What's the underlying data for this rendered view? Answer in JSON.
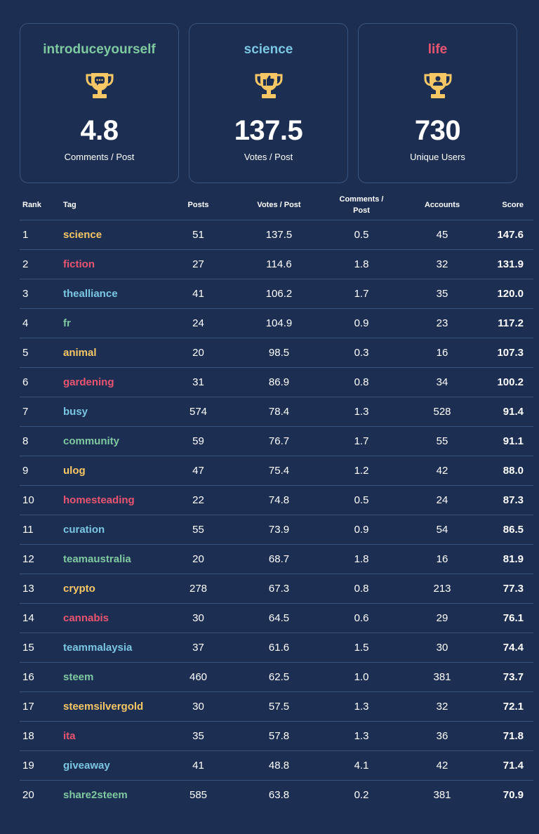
{
  "colors": {
    "background": "#1c2f52",
    "border": "#3a5480",
    "green": "#7fc9a0",
    "blue": "#7bc6e3",
    "red": "#ea5470",
    "yellow": "#f8c765"
  },
  "cards": [
    {
      "tag": "introduceyourself",
      "tag_color": "#7fc9a0",
      "icon": "trophy-comment-icon",
      "value": "4.8",
      "label": "Comments / Post"
    },
    {
      "tag": "science",
      "tag_color": "#7bc6e3",
      "icon": "trophy-thumbs-up-icon",
      "value": "137.5",
      "label": "Votes / Post"
    },
    {
      "tag": "life",
      "tag_color": "#ea5470",
      "icon": "trophy-user-icon",
      "value": "730",
      "label": "Unique Users"
    }
  ],
  "table": {
    "headers": {
      "rank": "Rank",
      "tag": "Tag",
      "posts": "Posts",
      "votes_per_post": "Votes / Post",
      "comments_per_post_line1": "Comments /",
      "comments_per_post_line2": "Post",
      "accounts": "Accounts",
      "score": "Score"
    },
    "rows": [
      {
        "rank": "1",
        "tag": "science",
        "tag_color": "#f8c765",
        "posts": "51",
        "votes": "137.5",
        "comments": "0.5",
        "accounts": "45",
        "score": "147.6"
      },
      {
        "rank": "2",
        "tag": "fiction",
        "tag_color": "#ea5470",
        "posts": "27",
        "votes": "114.6",
        "comments": "1.8",
        "accounts": "32",
        "score": "131.9"
      },
      {
        "rank": "3",
        "tag": "thealliance",
        "tag_color": "#7bc6e3",
        "posts": "41",
        "votes": "106.2",
        "comments": "1.7",
        "accounts": "35",
        "score": "120.0"
      },
      {
        "rank": "4",
        "tag": "fr",
        "tag_color": "#7fc9a0",
        "posts": "24",
        "votes": "104.9",
        "comments": "0.9",
        "accounts": "23",
        "score": "117.2"
      },
      {
        "rank": "5",
        "tag": "animal",
        "tag_color": "#f8c765",
        "posts": "20",
        "votes": "98.5",
        "comments": "0.3",
        "accounts": "16",
        "score": "107.3"
      },
      {
        "rank": "6",
        "tag": "gardening",
        "tag_color": "#ea5470",
        "posts": "31",
        "votes": "86.9",
        "comments": "0.8",
        "accounts": "34",
        "score": "100.2"
      },
      {
        "rank": "7",
        "tag": "busy",
        "tag_color": "#7bc6e3",
        "posts": "574",
        "votes": "78.4",
        "comments": "1.3",
        "accounts": "528",
        "score": "91.4"
      },
      {
        "rank": "8",
        "tag": "community",
        "tag_color": "#7fc9a0",
        "posts": "59",
        "votes": "76.7",
        "comments": "1.7",
        "accounts": "55",
        "score": "91.1"
      },
      {
        "rank": "9",
        "tag": "ulog",
        "tag_color": "#f8c765",
        "posts": "47",
        "votes": "75.4",
        "comments": "1.2",
        "accounts": "42",
        "score": "88.0"
      },
      {
        "rank": "10",
        "tag": "homesteading",
        "tag_color": "#ea5470",
        "posts": "22",
        "votes": "74.8",
        "comments": "0.5",
        "accounts": "24",
        "score": "87.3"
      },
      {
        "rank": "11",
        "tag": "curation",
        "tag_color": "#7bc6e3",
        "posts": "55",
        "votes": "73.9",
        "comments": "0.9",
        "accounts": "54",
        "score": "86.5"
      },
      {
        "rank": "12",
        "tag": "teamaustralia",
        "tag_color": "#7fc9a0",
        "posts": "20",
        "votes": "68.7",
        "comments": "1.8",
        "accounts": "16",
        "score": "81.9"
      },
      {
        "rank": "13",
        "tag": "crypto",
        "tag_color": "#f8c765",
        "posts": "278",
        "votes": "67.3",
        "comments": "0.8",
        "accounts": "213",
        "score": "77.3"
      },
      {
        "rank": "14",
        "tag": "cannabis",
        "tag_color": "#ea5470",
        "posts": "30",
        "votes": "64.5",
        "comments": "0.6",
        "accounts": "29",
        "score": "76.1"
      },
      {
        "rank": "15",
        "tag": "teammalaysia",
        "tag_color": "#7bc6e3",
        "posts": "37",
        "votes": "61.6",
        "comments": "1.5",
        "accounts": "30",
        "score": "74.4"
      },
      {
        "rank": "16",
        "tag": "steem",
        "tag_color": "#7fc9a0",
        "posts": "460",
        "votes": "62.5",
        "comments": "1.0",
        "accounts": "381",
        "score": "73.7"
      },
      {
        "rank": "17",
        "tag": "steemsilvergold",
        "tag_color": "#f8c765",
        "posts": "30",
        "votes": "57.5",
        "comments": "1.3",
        "accounts": "32",
        "score": "72.1"
      },
      {
        "rank": "18",
        "tag": "ita",
        "tag_color": "#ea5470",
        "posts": "35",
        "votes": "57.8",
        "comments": "1.3",
        "accounts": "36",
        "score": "71.8"
      },
      {
        "rank": "19",
        "tag": "giveaway",
        "tag_color": "#7bc6e3",
        "posts": "41",
        "votes": "48.8",
        "comments": "4.1",
        "accounts": "42",
        "score": "71.4"
      },
      {
        "rank": "20",
        "tag": "share2steem",
        "tag_color": "#7fc9a0",
        "posts": "585",
        "votes": "63.8",
        "comments": "0.2",
        "accounts": "381",
        "score": "70.9"
      }
    ]
  }
}
